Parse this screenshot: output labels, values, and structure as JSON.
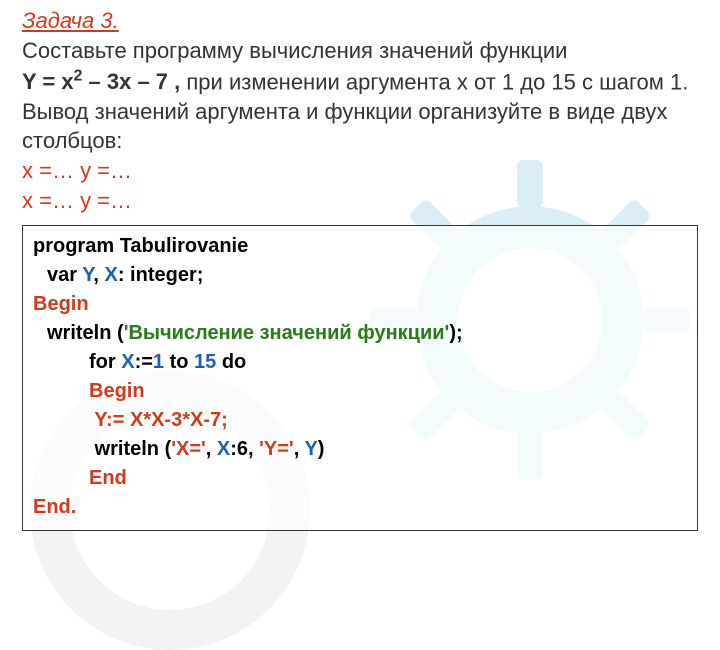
{
  "task_title": "Задача 3.",
  "problem": {
    "p1": "Составьте  программу  вычисления значений функции",
    "formula_pre": " Y = x",
    "formula_sup": "2",
    "formula_post": " – 3x – 7 ,",
    "p2": "  при  изменении  аргумента  х  от  1  до  15  с  шагом  1.  Вывод  значений  аргумента  и  функции организуйте в  виде  двух столбцов:",
    "row1": "x =…   y =…",
    "row2": "x =…   y =…"
  },
  "code": {
    "l1_program": "program ",
    "l1_name": "Tabulirovanie",
    "l2_var": "var ",
    "l2_Y": "Y",
    "l2_comma": ", ",
    "l2_X": "X",
    "l2_rest": ": integer;",
    "l3_begin": "Begin",
    "l4_writeln": "writeln ",
    "l4_paren_open": "(",
    "l4_str": "'Вычисление значений функции'",
    "l4_paren_close": ");",
    "l5_for": "for ",
    "l5_X": "X",
    "l5_assign": ":=",
    "l5_1": "1",
    "l5_to": " to ",
    "l5_15": "15",
    "l5_do": " do",
    "l6_begin": "Begin",
    "l7_assign": " Y:= X*X-3*X-7;",
    "l8_writeln": " writeln ",
    "l8_paren_open": "(",
    "l8_q1": "'X='",
    "l8_c1": ", ",
    "l8_X": "X",
    "l8_colon6": ":6, ",
    "l8_q2": "'Y='",
    "l8_c2": ", ",
    "l8_Y": "Y",
    "l8_paren_close": ")",
    "l9_end": "End",
    "l10_end": "End."
  }
}
